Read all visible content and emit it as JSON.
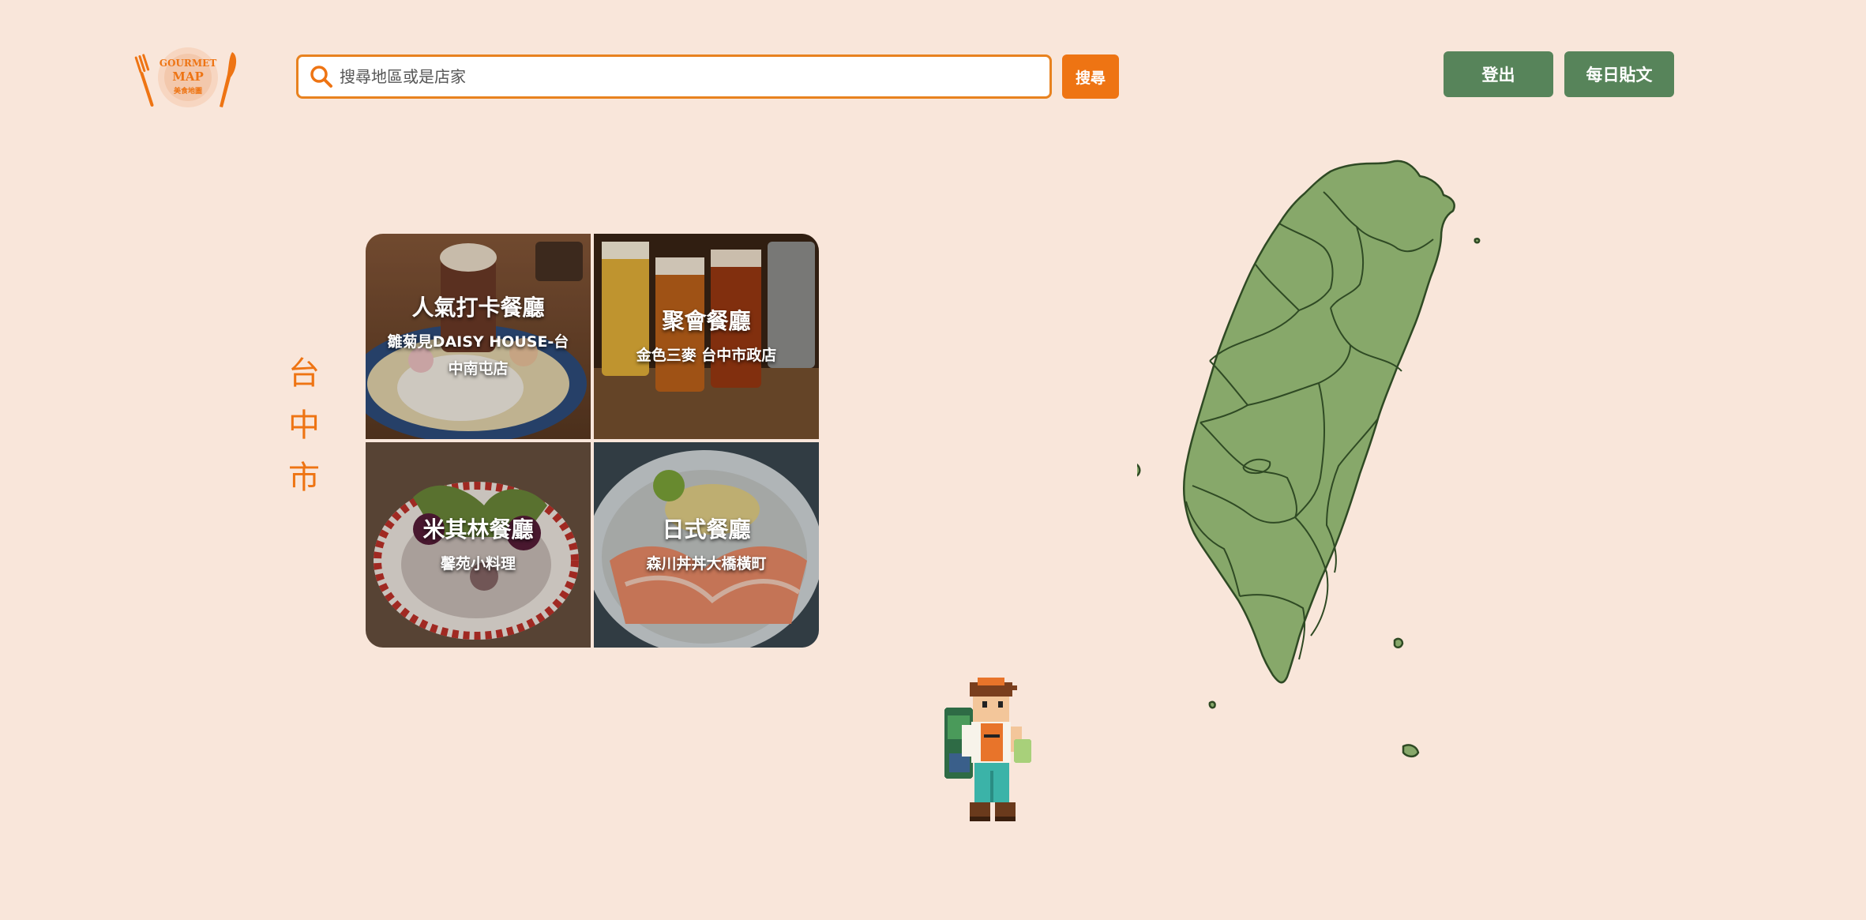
{
  "header": {
    "logo": {
      "top_text": "GOURMET",
      "mid_text": "MAP",
      "sub_text": "美食地圖",
      "icon": "fork-knife-plate-logo"
    },
    "search": {
      "placeholder": "搜尋地區或是店家",
      "value": "",
      "button_label": "搜尋",
      "icon": "search-icon"
    },
    "nav": {
      "logout_label": "登出",
      "daily_post_label": "每日貼文"
    }
  },
  "city": "台中市",
  "categories": [
    {
      "title": "人氣打卡餐廳",
      "shop": "雛菊見DAISY HOUSE-台中南屯店"
    },
    {
      "title": "聚會餐廳",
      "shop": "金色三麥 台中市政店"
    },
    {
      "title": "米其林餐廳",
      "shop": "馨苑小料理"
    },
    {
      "title": "日式餐廳",
      "shop": "森川丼丼大橋橫町"
    }
  ],
  "map": {
    "region": "Taiwan",
    "fill_color": "#87a86a",
    "stroke_color": "#2f4a24"
  },
  "colors": {
    "background": "#f9e6da",
    "accent": "#ee7413",
    "nav_button": "#57845a"
  }
}
